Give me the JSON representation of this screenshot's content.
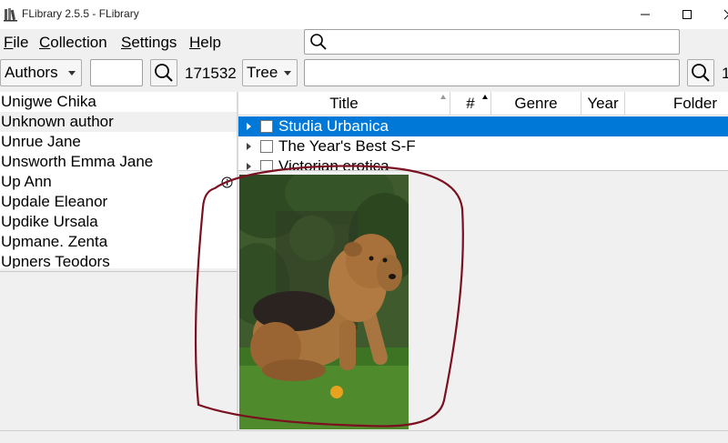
{
  "window": {
    "title": "FLibrary 2.5.5 - FLibrary",
    "icons": {
      "app": "books-icon",
      "minimize": "minimize-icon",
      "maximize": "maximize-icon",
      "close": "close-icon"
    }
  },
  "menu": {
    "items": [
      {
        "mnemonic": "F",
        "rest": "ile"
      },
      {
        "mnemonic": "C",
        "rest": "ollection"
      },
      {
        "mnemonic": "S",
        "rest": "ettings"
      },
      {
        "mnemonic": "H",
        "rest": "elp"
      }
    ]
  },
  "search_top": {
    "value": "",
    "icon": "search-icon"
  },
  "toolbar": {
    "navigation_mode": "Authors",
    "author_filter": "",
    "book_count": "171532",
    "view_mode": "Tree",
    "book_filter": "",
    "trailing_text": "1"
  },
  "authors": [
    "Unigwe Chika",
    "Unknown author",
    "Unrue Jane",
    "Unsworth Emma Jane",
    "Up Ann",
    "Updale Eleanor",
    "Updike Ursala",
    "Upmane. Zenta",
    "Upners Teodors"
  ],
  "table": {
    "columns": [
      "Title",
      "#",
      "Genre",
      "Year",
      "Folder"
    ],
    "rows": [
      {
        "title": "Studia Urbanica",
        "selected": true
      },
      {
        "title": "The Year's Best S-F",
        "selected": false
      },
      {
        "title": "Victorian erotica",
        "selected": false
      }
    ]
  },
  "colors": {
    "selection": "#0078d7",
    "annotation": "#7a1020"
  },
  "preview": {
    "image": "airedale-dog-on-grass",
    "info_icon": "info-icon"
  }
}
